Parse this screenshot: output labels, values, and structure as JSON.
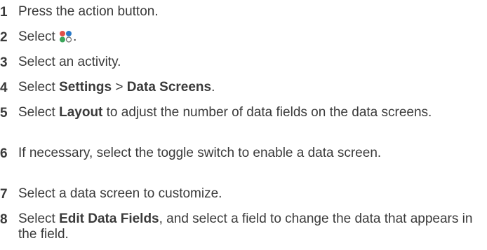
{
  "steps": [
    {
      "num": "1",
      "parts": [
        {
          "t": "Press the action button."
        }
      ]
    },
    {
      "num": "2",
      "parts": [
        {
          "t": "Select "
        },
        {
          "icon": "activities-icon"
        },
        {
          "t": "."
        }
      ]
    },
    {
      "num": "3",
      "parts": [
        {
          "t": "Select an activity."
        }
      ]
    },
    {
      "num": "4",
      "parts": [
        {
          "t": "Select "
        },
        {
          "b": "Settings"
        },
        {
          "t": " > "
        },
        {
          "b": "Data Screens"
        },
        {
          "t": "."
        }
      ]
    },
    {
      "num": "5",
      "parts": [
        {
          "t": "Select "
        },
        {
          "b": "Layout"
        },
        {
          "t": " to adjust the number of data fields on the data screens."
        }
      ]
    },
    {
      "num": "6",
      "parts": [
        {
          "t": "If necessary, select the toggle switch to enable a data screen."
        }
      ]
    },
    {
      "num": "7",
      "parts": [
        {
          "t": "Select a data screen to customize."
        }
      ]
    },
    {
      "num": "8",
      "parts": [
        {
          "t": "Select "
        },
        {
          "b": "Edit Data Fields"
        },
        {
          "t": ", and select a field to change the data that appears in the field."
        }
      ]
    }
  ],
  "icon_colors": {
    "top_left": "#e0504a",
    "top_right": "#2b7ac8",
    "bottom_left": "#3aa55a",
    "bottom_right_outline": "#6b6b6b"
  }
}
